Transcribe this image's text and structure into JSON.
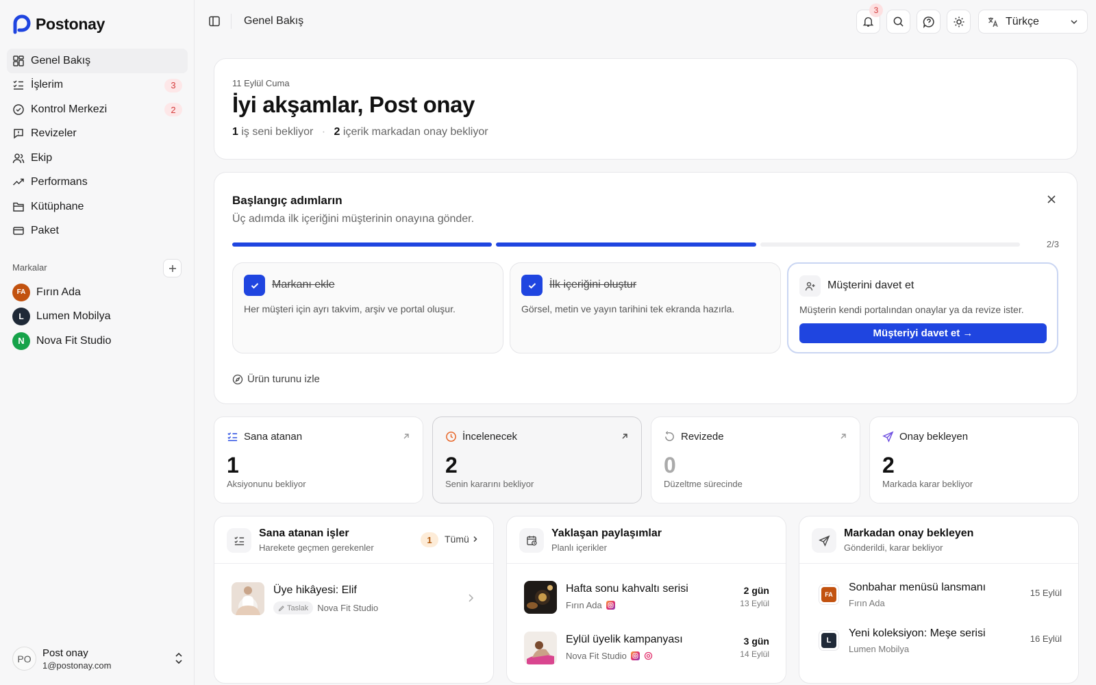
{
  "app": {
    "name": "Postonay",
    "brand_color": "#1f45e0"
  },
  "sidebar": {
    "nav": [
      {
        "label": "Genel Bakış",
        "icon": "dashboard-icon",
        "active": true
      },
      {
        "label": "İşlerim",
        "icon": "tasks-icon",
        "badge": "3"
      },
      {
        "label": "Kontrol Merkezi",
        "icon": "check-circle-icon",
        "badge": "2"
      },
      {
        "label": "Revizeler",
        "icon": "message-alert-icon"
      },
      {
        "label": "Ekip",
        "icon": "users-icon"
      },
      {
        "label": "Performans",
        "icon": "trend-icon"
      },
      {
        "label": "Kütüphane",
        "icon": "folder-icon"
      },
      {
        "label": "Paket",
        "icon": "card-icon"
      }
    ],
    "brands_title": "Markalar",
    "brands": [
      {
        "name": "Fırın Ada",
        "initials": "FA",
        "color": "#c2520f"
      },
      {
        "name": "Lumen Mobilya",
        "initials": "L",
        "color": "#1f2937"
      },
      {
        "name": "Nova Fit Studio",
        "initials": "N",
        "color": "#16a34a"
      }
    ],
    "user": {
      "initials": "PO",
      "name": "Post onay",
      "email": "1@postonay.com"
    }
  },
  "topbar": {
    "breadcrumb": "Genel Bakış",
    "notification_count": "3",
    "language": "Türkçe"
  },
  "greeting": {
    "date": "11 Eylül Cuma",
    "title": "İyi akşamlar, Post onay",
    "waiting_count": "1",
    "waiting_text": "iş seni bekliyor",
    "approval_count": "2",
    "approval_text": "içerik markadan onay bekliyor"
  },
  "onboarding": {
    "title": "Başlangıç adımların",
    "subtitle": "Üç adımda ilk içeriğini müşterinin onayına gönder.",
    "progress": {
      "completed": 2,
      "total": 3
    },
    "progress_label": "2/3",
    "steps": [
      {
        "title": "Markanı ekle",
        "desc": "Her müşteri için ayrı takvim, arşiv ve portal oluşur.",
        "done": true
      },
      {
        "title": "İlk içeriğini oluştur",
        "desc": "Görsel, metin ve yayın tarihini tek ekranda hazırla.",
        "done": true
      },
      {
        "title": "Müşterini davet et",
        "desc": "Müşterin kendi portalından onaylar ya da revize ister.",
        "done": false,
        "cta": "Müşteriyi davet et →"
      }
    ],
    "tour_label": "Ürün turunu izle"
  },
  "stats": [
    {
      "label": "Sana atanan",
      "value": "1",
      "sub": "Aksiyonunu bekliyor",
      "icon": "list-check-icon",
      "color": "#1f45e0"
    },
    {
      "label": "İncelenecek",
      "value": "2",
      "sub": "Senin kararını bekliyor",
      "icon": "clock-icon",
      "color": "#e8672a"
    },
    {
      "label": "Revizede",
      "value": "0",
      "sub": "Düzeltme sürecinde",
      "icon": "rotate-icon",
      "color": "#888888"
    },
    {
      "label": "Onay bekleyen",
      "value": "2",
      "sub": "Markada karar bekliyor",
      "icon": "send-icon",
      "color": "#6d4ee0"
    }
  ],
  "assigned_panel": {
    "title": "Sana atanan işler",
    "subtitle": "Harekete geçmen gerekenler",
    "count": "1",
    "all_label": "Tümü",
    "items": [
      {
        "title": "Üye hikâyesi: Elif",
        "status": "Taslak",
        "brand": "Nova Fit Studio"
      }
    ]
  },
  "upcoming_panel": {
    "title": "Yaklaşan paylaşımlar",
    "subtitle": "Planlı içerikler",
    "items": [
      {
        "title": "Hafta sonu kahvaltı serisi",
        "brand": "Fırın Ada",
        "relative": "2 gün",
        "date": "13 Eylül"
      },
      {
        "title": "Eylül üyelik kampanyası",
        "brand": "Nova Fit Studio",
        "relative": "3 gün",
        "date": "14 Eylül"
      }
    ]
  },
  "approval_panel": {
    "title": "Markadan onay bekleyen",
    "subtitle": "Gönderildi, karar bekliyor",
    "items": [
      {
        "title": "Sonbahar menüsü lansmanı",
        "brand": "Fırın Ada",
        "initials": "FA",
        "color": "#c2520f",
        "date": "15 Eylül"
      },
      {
        "title": "Yeni koleksiyon: Meşe serisi",
        "brand": "Lumen Mobilya",
        "initials": "L",
        "color": "#1f2937",
        "date": "16 Eylül"
      }
    ]
  }
}
